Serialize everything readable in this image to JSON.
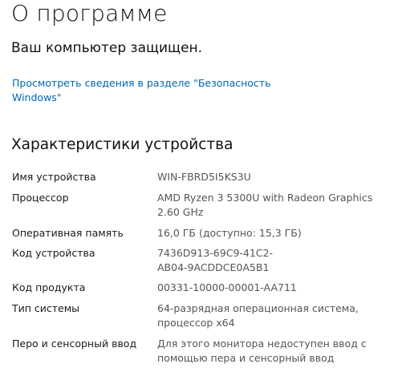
{
  "page": {
    "title": "О программе",
    "protection_status": "Ваш компьютер защищен.",
    "security_link": "Просмотреть сведения в разделе \"Безопасность Windows\""
  },
  "device_specs": {
    "section_title": "Характеристики устройства",
    "rows": [
      {
        "label": "Имя устройства",
        "value": "WIN-FBRD5I5KS3U"
      },
      {
        "label": "Процессор",
        "value": "AMD Ryzen 3 5300U with Radeon Graphics\n2.60 GHz"
      },
      {
        "label": "Оперативная память",
        "value": "16,0 ГБ (доступно: 15,3 ГБ)"
      },
      {
        "label": "Код устройства",
        "value": "7436D913-69C9-41C2-\nAB04-9ACDDCE0A5B1"
      },
      {
        "label": "Код продукта",
        "value": "00331-10000-00001-AA711"
      },
      {
        "label": "Тип системы",
        "value": "64-разрядная операционная система,\nпроцессор x64"
      },
      {
        "label": "Перо и сенсорный ввод",
        "value": "Для этого монитора недоступен ввод с\nпомощью пера и сенсорный ввод"
      }
    ]
  },
  "colors": {
    "link": "#0066b4",
    "value_text": "#555555",
    "label_text": "#1a1a1a",
    "background": "#ffffff"
  }
}
